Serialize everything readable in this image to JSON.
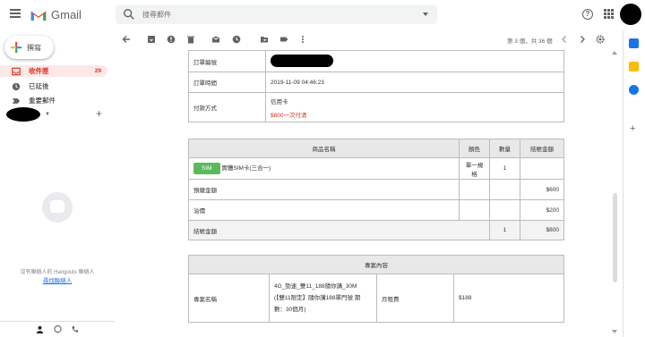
{
  "header": {
    "app_name": "Gmail",
    "search_placeholder": "搜尋郵件",
    "help_label": "?"
  },
  "sidebar": {
    "compose_label": "撰寫",
    "items": [
      {
        "label": "收件匣",
        "count": "29",
        "icon": "inbox-icon",
        "active": true
      },
      {
        "label": "已延後",
        "icon": "clock-icon"
      },
      {
        "label": "重要郵件",
        "icon": "important-icon"
      }
    ],
    "hangouts": {
      "empty_message": "沒有聯絡人的 Hangouts 聯絡人",
      "find_link": "尋找聯絡人"
    }
  },
  "toolbar": {
    "counter": "第 3 個，共 36 個"
  },
  "order_table": {
    "rows": [
      {
        "label": "訂單編號",
        "value": ""
      },
      {
        "label": "訂單時間",
        "value": "2019-11-09 04:46:23"
      },
      {
        "label": "付款方式",
        "value": "信用卡",
        "note": "$800一次付清"
      }
    ]
  },
  "product_table": {
    "headers": [
      "商品名稱",
      "顏色",
      "數量",
      "結帳金額"
    ],
    "sim_badge": "SIM",
    "item_name": "實體SIM卡(三合一)",
    "item_color": "單一規格",
    "item_qty": "1",
    "prepay_label": "預繳金額",
    "prepay_amount": "$600",
    "deposit_label": "溢價",
    "deposit_amount": "$200",
    "total_label": "結帳金額",
    "total_qty": "1",
    "total_amount": "$800"
  },
  "plan_table": {
    "header": "專案內容",
    "name_label": "專案名稱",
    "plan_name_line1": "4G_勁速_雙11_188隨你講_30M",
    "plan_name_line2": "(【雙11限定】隨你講188單門號 期",
    "plan_name_line3": "數：30個月)",
    "monthly_label": "月租費",
    "monthly_value": "$188"
  },
  "colors": {
    "gmail_red": "#d93025",
    "sim_green": "#5cb85c",
    "active_bg": "#fce8e6"
  }
}
